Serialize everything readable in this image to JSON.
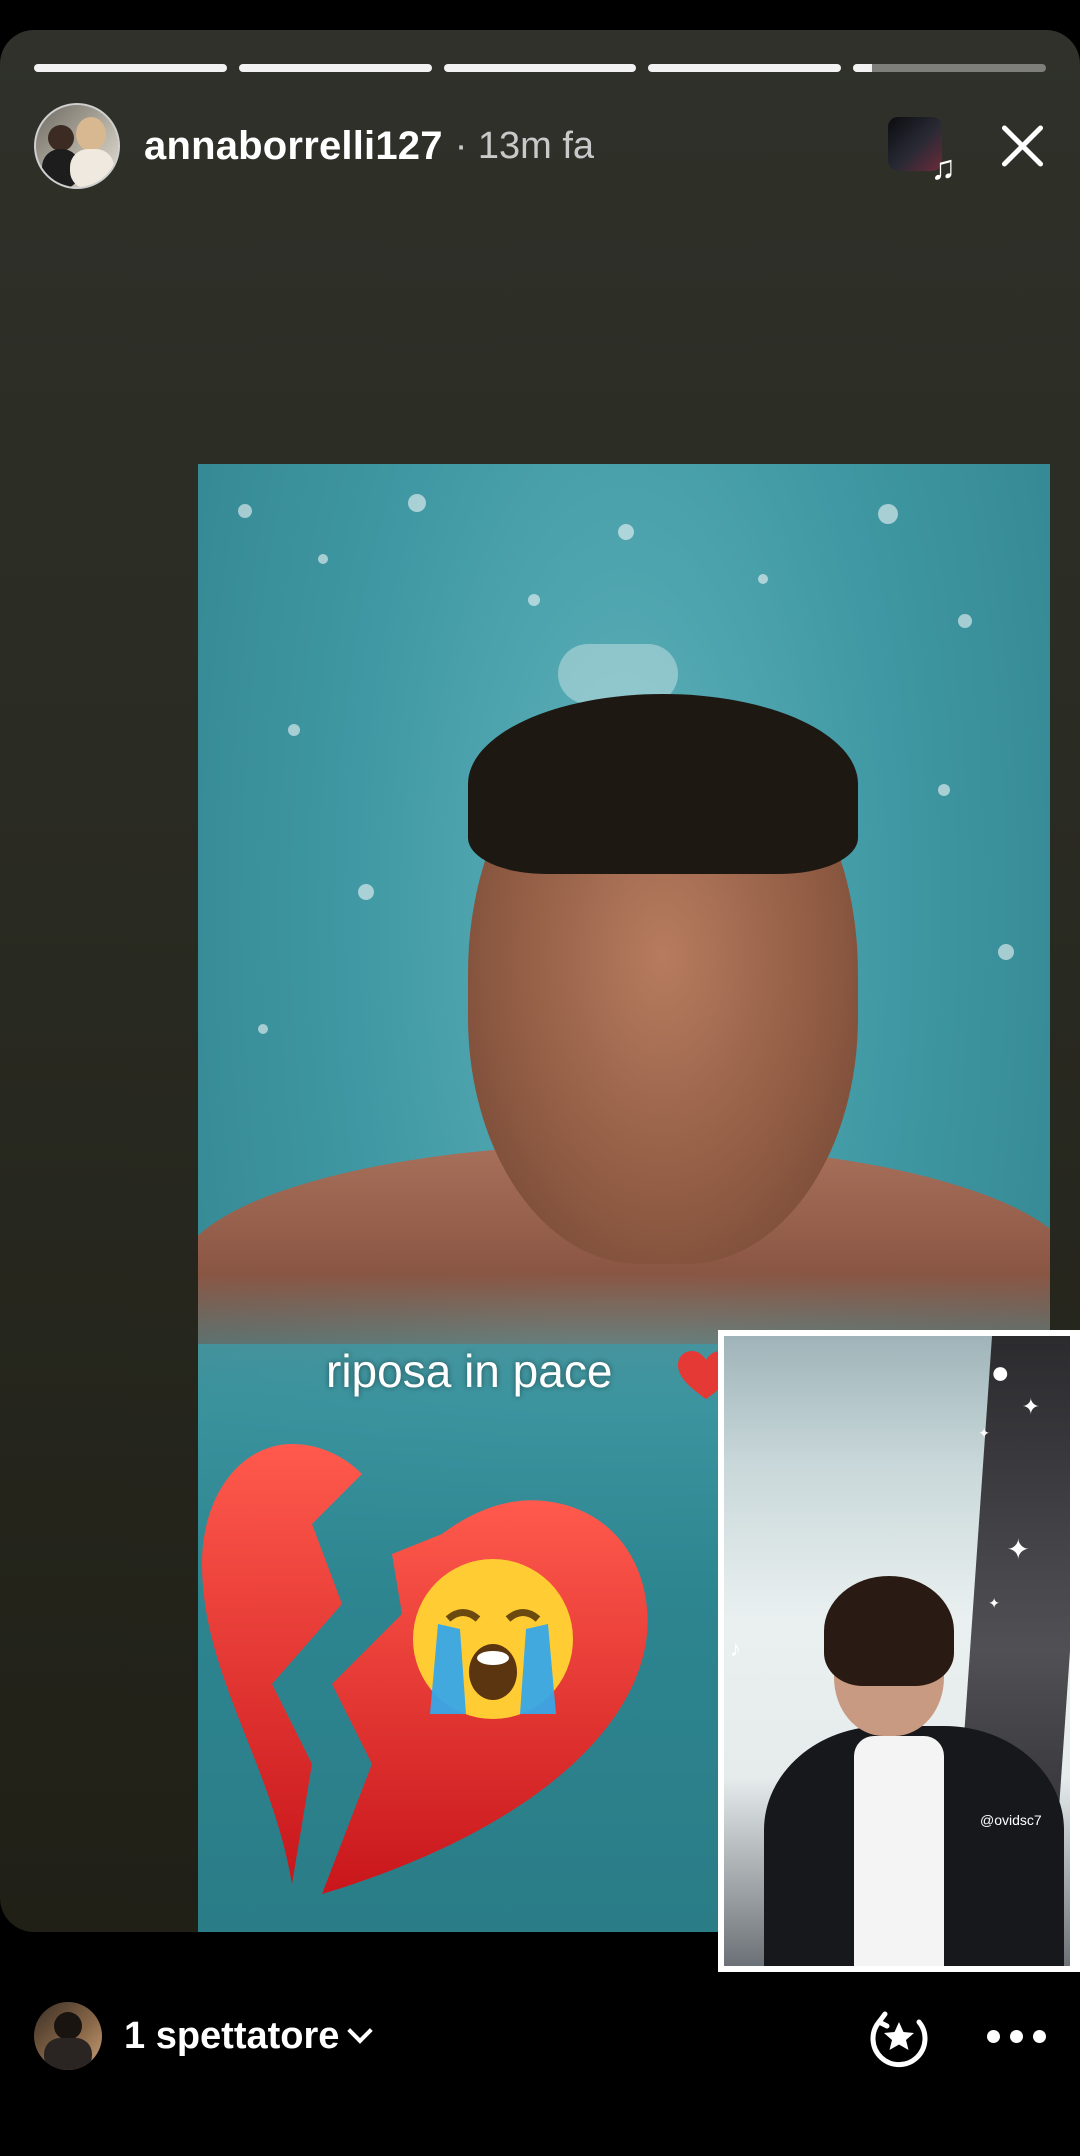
{
  "story": {
    "segments": [
      1,
      1,
      1,
      1,
      0.1
    ],
    "user": {
      "username": "annaborrelli127",
      "time": "· 13m fa"
    },
    "music_icon": "music-note-icon",
    "close_icon": "close-icon"
  },
  "post": {
    "caption": "riposa in pace",
    "emoji": [
      "red-heart",
      "broken-heart",
      "loudly-crying-face"
    ]
  },
  "overlay": {
    "tiktok_handle": "@ovidsc7"
  },
  "footer": {
    "viewers": "1 spettatore",
    "highlight_icon": "star-highlight-icon",
    "more_icon": "more-icon"
  }
}
